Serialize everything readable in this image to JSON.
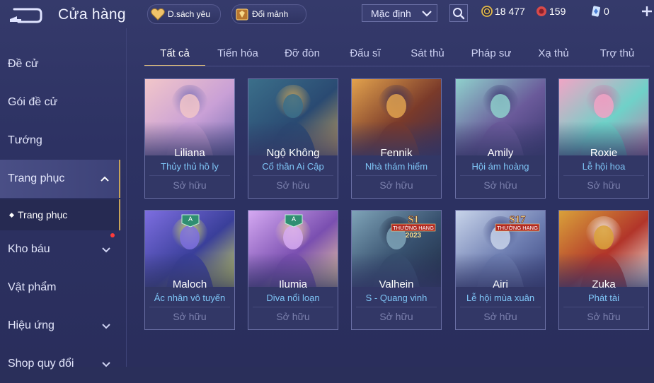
{
  "header": {
    "title": "Cửa hàng",
    "wishlist_label": "D.sách yêu",
    "shards_label": "Đổi mảnh",
    "sort_value": "Mặc định"
  },
  "currencies": [
    {
      "name": "gold-coin",
      "value": "18 477",
      "color": "#e3b94a"
    },
    {
      "name": "voucher",
      "value": "159",
      "color": "#d84a4a"
    },
    {
      "name": "diamond",
      "value": "0",
      "color": "#7fb8ff"
    }
  ],
  "sidebar": {
    "items": [
      {
        "label": "Đề cử"
      },
      {
        "label": "Gói đề cử"
      },
      {
        "label": "Tướng"
      },
      {
        "label": "Trang phục"
      },
      {
        "label": "Kho báu"
      },
      {
        "label": "Vật phẩm"
      },
      {
        "label": "Hiệu ứng"
      },
      {
        "label": "Shop quy đổi"
      }
    ],
    "sub_item": "Trang phục"
  },
  "tabs": [
    {
      "label": "Tất cả"
    },
    {
      "label": "Tiến hóa"
    },
    {
      "label": "Đỡ đòn"
    },
    {
      "label": "Đấu sĩ"
    },
    {
      "label": "Sát thủ"
    },
    {
      "label": "Pháp sư"
    },
    {
      "label": "Xạ thủ"
    },
    {
      "label": "Trợ thủ"
    }
  ],
  "cards": [
    {
      "name": "Liliana",
      "skin": "Thủy thủ hồ ly",
      "status": "Sở hữu",
      "palette": [
        "#f2c6c9",
        "#c9a0d6",
        "#7a6fb6"
      ]
    },
    {
      "name": "Ngộ Không",
      "skin": "Cổ thần Ai Cập",
      "status": "Sở hữu",
      "palette": [
        "#3b6f8a",
        "#2a4a72",
        "#caa45a"
      ]
    },
    {
      "name": "Fennik",
      "skin": "Nhà thám hiểm",
      "status": "Sở hữu",
      "palette": [
        "#e2a24d",
        "#7a3a2a",
        "#3c2e52"
      ]
    },
    {
      "name": "Amily",
      "skin": "Hội ám hoàng",
      "status": "Sở hữu",
      "palette": [
        "#8fd0cc",
        "#6a5a9a",
        "#3a3770"
      ]
    },
    {
      "name": "Roxie",
      "skin": "Lễ hội hoa",
      "status": "Sở hữu",
      "palette": [
        "#f0a5c5",
        "#6fd1c8",
        "#c47aa8"
      ]
    },
    {
      "name": "Maloch",
      "skin": "Ác nhân vô tuyến",
      "status": "Sở hữu",
      "palette": [
        "#7d6ee0",
        "#3a3f9a",
        "#d8e25a"
      ],
      "badge": "A"
    },
    {
      "name": "Ilumia",
      "skin": "Diva nổi loạn",
      "status": "Sở hữu",
      "palette": [
        "#d5a9f2",
        "#7a4fb0",
        "#f3d2a0"
      ],
      "badge": "A"
    },
    {
      "name": "Valhein",
      "skin": "S - Quang vinh",
      "status": "Sở hữu",
      "palette": [
        "#7fa4b8",
        "#37506e",
        "#1f2b44"
      ],
      "rank": "S1",
      "rank_label": "THƯỜNG HẠNG",
      "rank_year": "2023"
    },
    {
      "name": "Airi",
      "skin": "Lễ hội mùa xuân",
      "status": "Sở hữu",
      "palette": [
        "#c8d4ea",
        "#6f7fb2",
        "#3b4680"
      ],
      "rank": "S17",
      "rank_label": "THƯỜNG HẠNG"
    },
    {
      "name": "Zuka",
      "skin": "Phát tài",
      "status": "Sở hữu",
      "palette": [
        "#d9a13a",
        "#b2352a",
        "#f4efe6"
      ]
    }
  ]
}
